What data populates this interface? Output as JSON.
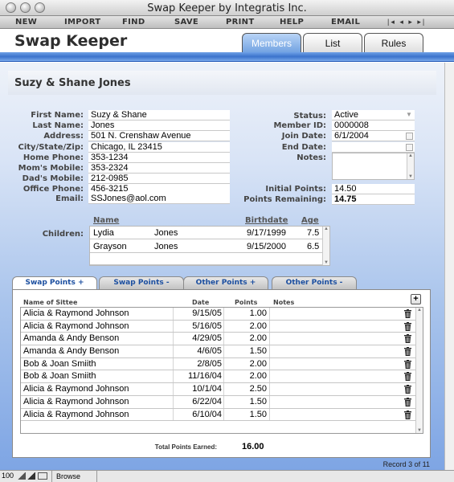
{
  "window": {
    "title": "Swap Keeper by Integratis Inc."
  },
  "menu": [
    "NEW",
    "IMPORT",
    "FIND",
    "SAVE",
    "PRINT",
    "HELP",
    "EMAIL"
  ],
  "nav_arrows": "|◂ ◂ ▸ ▸|",
  "app": {
    "title": "Swap Keeper"
  },
  "tabs": [
    {
      "label": "Members",
      "active": true
    },
    {
      "label": "List",
      "active": false
    },
    {
      "label": "Rules",
      "active": false
    }
  ],
  "record": {
    "name": "Suzy & Shane Jones"
  },
  "fields_left": [
    {
      "label": "First Name:",
      "value": "Suzy & Shane"
    },
    {
      "label": "Last Name:",
      "value": "Jones"
    },
    {
      "label": "Address:",
      "value": "501 N. Crenshaw Avenue"
    },
    {
      "label": "City/State/Zip:",
      "value": "Chicago, IL 23415"
    },
    {
      "label": "Home Phone:",
      "value": "353-1234"
    },
    {
      "label": "Mom's Mobile:",
      "value": "353-2324"
    },
    {
      "label": "Dad's Mobile:",
      "value": "212-0985"
    },
    {
      "label": "Office Phone:",
      "value": "456-3215"
    },
    {
      "label": "Email:",
      "value": "SSJones@aol.com"
    }
  ],
  "fields_right": {
    "status_label": "Status:",
    "status": "Active",
    "member_id_label": "Member ID:",
    "member_id": "0000008",
    "join_date_label": "Join Date:",
    "join_date": "6/1/2004",
    "end_date_label": "End Date:",
    "end_date": "",
    "notes_label": "Notes:",
    "notes": "",
    "initial_points_label": "Initial Points:",
    "initial_points": "14.50",
    "points_remaining_label": "Points Remaining:",
    "points_remaining": "14.75"
  },
  "children": {
    "label": "Children:",
    "headers": {
      "name": "Name",
      "birthdate": "Birthdate",
      "age": "Age"
    },
    "rows": [
      {
        "first": "Lydia",
        "last": "Jones",
        "birthdate": "9/17/1999",
        "age": "7.5"
      },
      {
        "first": "Grayson",
        "last": "Jones",
        "birthdate": "9/15/2000",
        "age": "6.5"
      }
    ]
  },
  "subtabs": [
    {
      "label": "Swap Points +",
      "active": true
    },
    {
      "label": "Swap Points -",
      "active": false
    },
    {
      "label": "Other Points +",
      "active": false
    },
    {
      "label": "Other Points -",
      "active": false
    }
  ],
  "portal": {
    "headers": {
      "name": "Name of Sittee",
      "date": "Date",
      "points": "Points",
      "notes": "Notes"
    },
    "add_label": "+",
    "rows": [
      {
        "name": "Alicia & Raymond Johnson",
        "date": "9/15/05",
        "points": "1.00"
      },
      {
        "name": "Alicia & Raymond Johnson",
        "date": "5/16/05",
        "points": "2.00"
      },
      {
        "name": "Amanda & Andy Benson",
        "date": "4/29/05",
        "points": "2.00"
      },
      {
        "name": "Amanda & Andy Benson",
        "date": "4/6/05",
        "points": "1.50"
      },
      {
        "name": "Bob & Joan Smiith",
        "date": "2/8/05",
        "points": "2.00"
      },
      {
        "name": "Bob & Joan Smiith",
        "date": "11/16/04",
        "points": "2.00"
      },
      {
        "name": "Alicia & Raymond Johnson",
        "date": "10/1/04",
        "points": "2.50"
      },
      {
        "name": "Alicia & Raymond Johnson",
        "date": "6/22/04",
        "points": "1.50"
      },
      {
        "name": "Alicia & Raymond Johnson",
        "date": "6/10/04",
        "points": "1.50"
      }
    ],
    "total_label": "Total Points Earned:",
    "total_value": "16.00"
  },
  "record_counter": "Record 3 of 11",
  "statusbar": {
    "zoom": "100",
    "mode": "Browse"
  },
  "colors": {
    "accent": "#3b73cc",
    "tab_active": "#6d9fe0",
    "link_text": "#1c4fa0"
  }
}
